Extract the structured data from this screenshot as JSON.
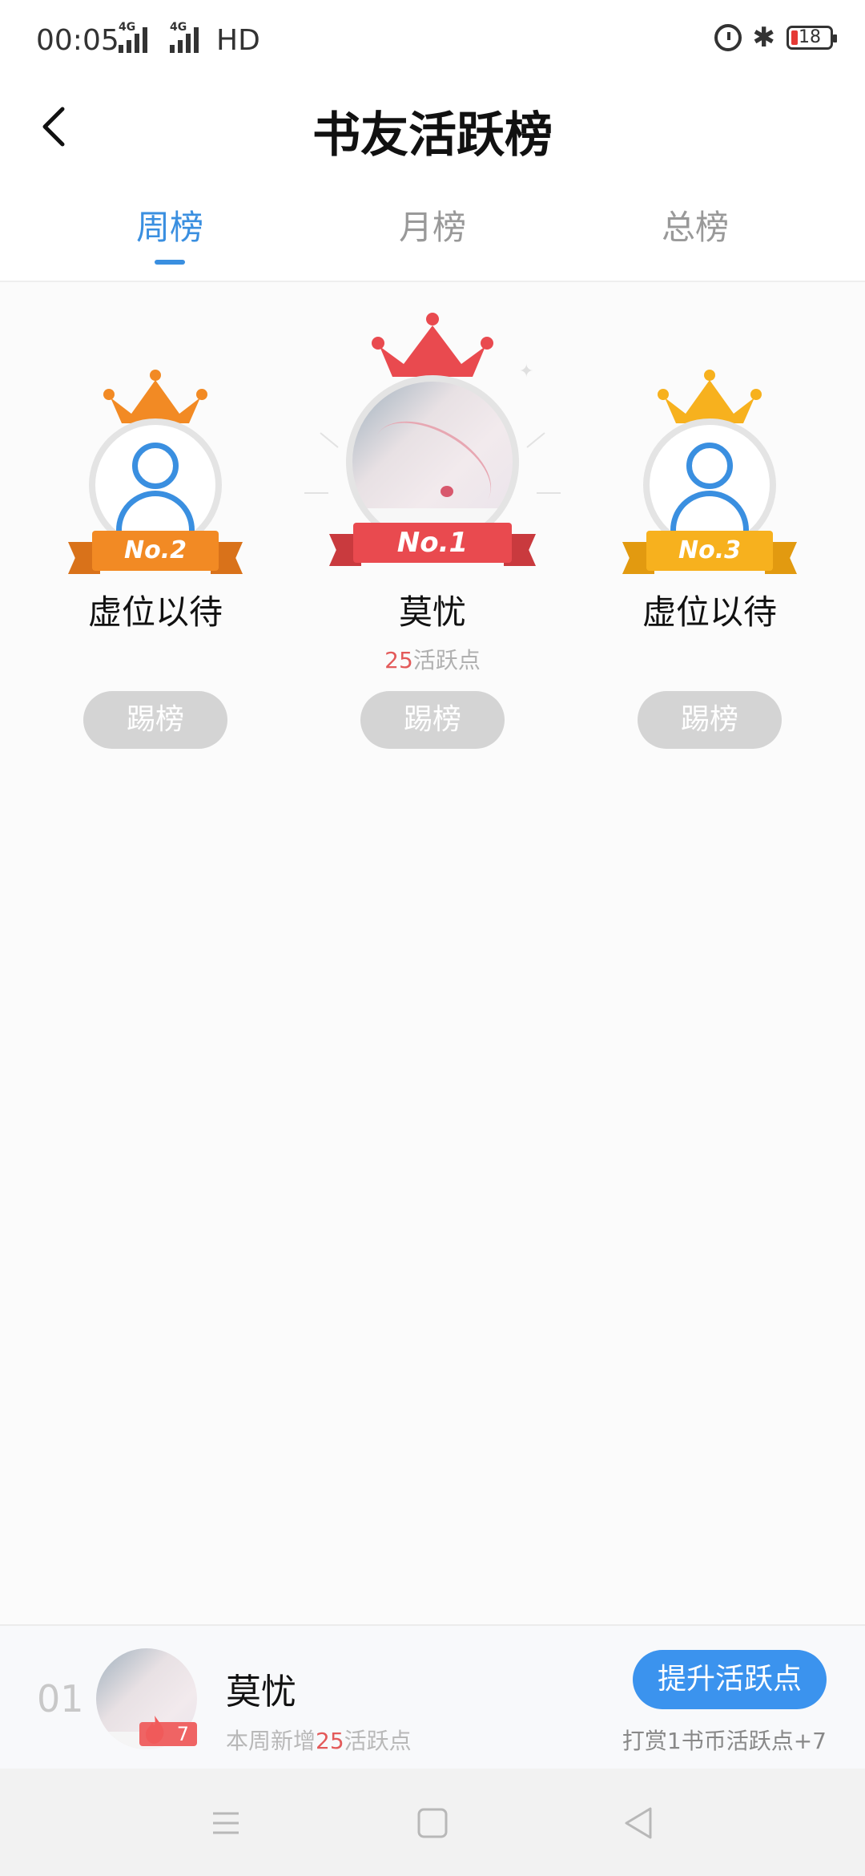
{
  "status_bar": {
    "time": "00:05",
    "network_1": "4G",
    "network_2": "4G",
    "hd": "HD",
    "battery": "18"
  },
  "header": {
    "title": "书友活跃榜"
  },
  "tabs": [
    {
      "label": "周榜",
      "active": true
    },
    {
      "label": "月榜",
      "active": false
    },
    {
      "label": "总榜",
      "active": false
    }
  ],
  "podium": {
    "first": {
      "rank_label": "No.1",
      "name": "莫忧",
      "points_value": "25",
      "points_unit": "活跃点",
      "kick_label": "踢榜"
    },
    "second": {
      "rank_label": "No.2",
      "name": "虚位以待",
      "kick_label": "踢榜"
    },
    "third": {
      "rank_label": "No.3",
      "name": "虚位以待",
      "kick_label": "踢榜"
    }
  },
  "my_rank": {
    "rank": "01",
    "name": "莫忧",
    "fire_count": "7",
    "points_prefix": "本周新增",
    "points_value": "25",
    "points_unit": "活跃点",
    "boost_label": "提升活跃点",
    "tip": "打赏1书币活跃点+7"
  },
  "colors": {
    "accent": "#3a8fe0",
    "first": "#e94a4f",
    "second": "#f28a24",
    "third": "#f7b11e",
    "highlight": "#e35a5a"
  },
  "icons": [
    "back-arrow-icon",
    "alarm-icon",
    "bluetooth-icon",
    "battery-icon",
    "crown-icon",
    "user-placeholder-icon",
    "fire-icon",
    "menu-icon",
    "home-icon",
    "back-triangle-icon"
  ]
}
